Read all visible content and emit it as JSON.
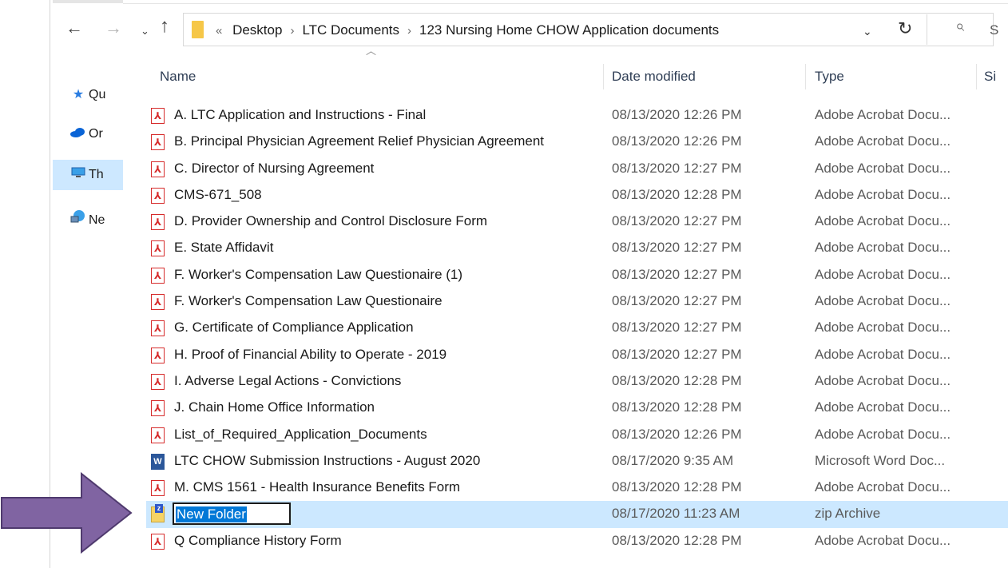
{
  "nav": {
    "back": "←",
    "forward": "→",
    "recent": "⌄",
    "up": "↑"
  },
  "address": {
    "overflow": "«",
    "crumbs": [
      "Desktop",
      "LTC Documents",
      "123 Nursing Home CHOW Application documents"
    ],
    "separator": "›",
    "dropdown": "⌄",
    "refresh": "↻",
    "search_glyph": "⌕",
    "search_partial": "S"
  },
  "nav_pane": {
    "items": [
      {
        "label": "Qu",
        "icon": "star-icon"
      },
      {
        "label": "Or",
        "icon": "cloud-icon"
      },
      {
        "label": "Th",
        "icon": "monitor-icon"
      },
      {
        "label": "Ne",
        "icon": "network-icon"
      }
    ]
  },
  "columns": {
    "name": "Name",
    "date": "Date modified",
    "type": "Type",
    "size": "Si"
  },
  "files": [
    {
      "name": "A. LTC Application and Instructions - Final",
      "date": "08/13/2020 12:26 PM",
      "type": "Adobe Acrobat Docu...",
      "icon": "pdf"
    },
    {
      "name": "B. Principal Physician Agreement Relief Physician Agreement",
      "date": "08/13/2020 12:26 PM",
      "type": "Adobe Acrobat Docu...",
      "icon": "pdf"
    },
    {
      "name": "C. Director of Nursing Agreement",
      "date": "08/13/2020 12:27 PM",
      "type": "Adobe Acrobat Docu...",
      "icon": "pdf"
    },
    {
      "name": "CMS-671_508",
      "date": "08/13/2020 12:28 PM",
      "type": "Adobe Acrobat Docu...",
      "icon": "pdf"
    },
    {
      "name": "D. Provider Ownership and Control Disclosure Form",
      "date": "08/13/2020 12:27 PM",
      "type": "Adobe Acrobat Docu...",
      "icon": "pdf"
    },
    {
      "name": "E. State Affidavit",
      "date": "08/13/2020 12:27 PM",
      "type": "Adobe Acrobat Docu...",
      "icon": "pdf"
    },
    {
      "name": "F. Worker's Compensation Law Questionaire (1)",
      "date": "08/13/2020 12:27 PM",
      "type": "Adobe Acrobat Docu...",
      "icon": "pdf"
    },
    {
      "name": "F. Worker's Compensation Law Questionaire",
      "date": "08/13/2020 12:27 PM",
      "type": "Adobe Acrobat Docu...",
      "icon": "pdf"
    },
    {
      "name": "G. Certificate of Compliance Application",
      "date": "08/13/2020 12:27 PM",
      "type": "Adobe Acrobat Docu...",
      "icon": "pdf"
    },
    {
      "name": "H. Proof of Financial Ability to Operate - 2019",
      "date": "08/13/2020 12:27 PM",
      "type": "Adobe Acrobat Docu...",
      "icon": "pdf"
    },
    {
      "name": "I. Adverse Legal Actions - Convictions",
      "date": "08/13/2020 12:28 PM",
      "type": "Adobe Acrobat Docu...",
      "icon": "pdf"
    },
    {
      "name": "J. Chain Home Office Information",
      "date": "08/13/2020 12:28 PM",
      "type": "Adobe Acrobat Docu...",
      "icon": "pdf"
    },
    {
      "name": "List_of_Required_Application_Documents",
      "date": "08/13/2020 12:26 PM",
      "type": "Adobe Acrobat Docu...",
      "icon": "pdf"
    },
    {
      "name": "LTC CHOW Submission Instructions - August 2020",
      "date": "08/17/2020 9:35 AM",
      "type": "Microsoft Word Doc...",
      "icon": "word"
    },
    {
      "name": "M. CMS 1561 - Health Insurance Benefits Form",
      "date": "08/13/2020 12:28 PM",
      "type": "Adobe Acrobat Docu...",
      "icon": "pdf"
    },
    {
      "name": "New Folder",
      "date": "08/17/2020 11:23 AM",
      "type": "zip Archive",
      "icon": "zip",
      "selected": true,
      "renaming": true
    },
    {
      "name": "Q Compliance History Form",
      "date": "08/13/2020 12:28 PM",
      "type": "Adobe Acrobat Docu...",
      "icon": "pdf"
    }
  ],
  "colors": {
    "selection": "#cce8ff",
    "arrow_fill": "#8064a2",
    "arrow_stroke": "#4f3a6e",
    "rename_highlight": "#0078d7"
  }
}
